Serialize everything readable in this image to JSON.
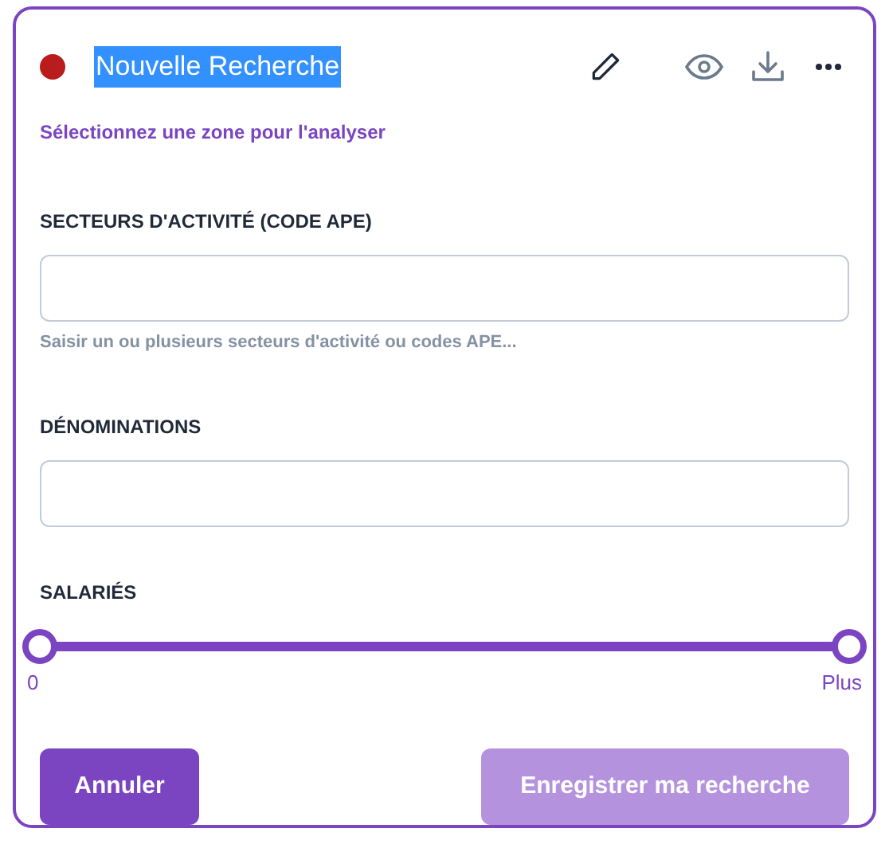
{
  "header": {
    "title": "Nouvelle Recherche",
    "title_selected": true
  },
  "subtitle": "Sélectionnez une zone pour l'analyser",
  "fields": [
    {
      "label": "SECTEURS D'ACTIVITÉ (CODE APE)",
      "hint": "Saisir un ou plusieurs secteurs d'activité ou codes APE..."
    },
    {
      "label": "DÉNOMINATIONS"
    }
  ],
  "salaries": {
    "label": "SALARIÉS",
    "thumbs": [
      {
        "level": 0
      },
      {
        "level": 1
      }
    ],
    "min_label": "0",
    "max_label": "Plus"
  },
  "buttons": [
    {
      "label": "Annuler",
      "disabled": false
    },
    {
      "label": "Enregistrer ma recherche",
      "disabled": true
    }
  ]
}
